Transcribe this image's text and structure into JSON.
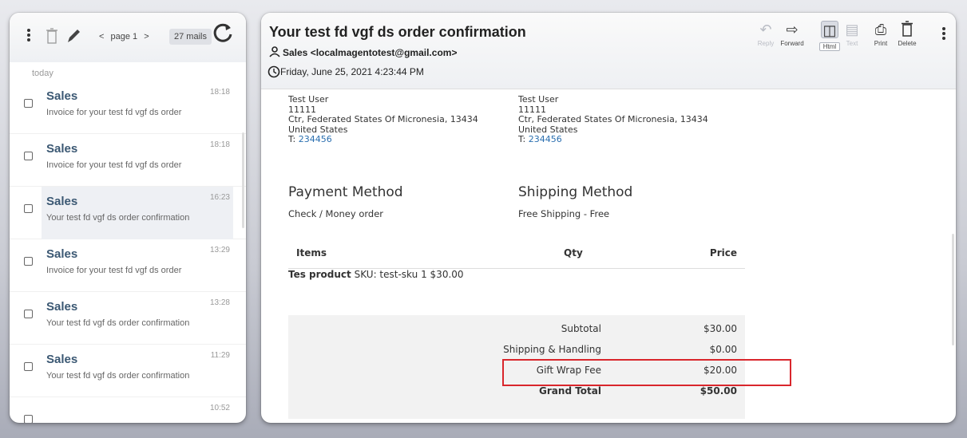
{
  "left": {
    "pager_prev": "<",
    "page_label": "page 1",
    "pager_next": ">",
    "mail_count": "27 mails",
    "group_label": "today",
    "items": [
      {
        "from": "Sales",
        "subject": "Invoice for your test fd vgf ds order",
        "time": "18:18"
      },
      {
        "from": "Sales",
        "subject": "Invoice for your test fd vgf ds order",
        "time": "18:18"
      },
      {
        "from": "Sales",
        "subject": "Your test fd vgf ds order confirmation",
        "time": "16:23"
      },
      {
        "from": "Sales",
        "subject": "Invoice for your test fd vgf ds order",
        "time": "13:29"
      },
      {
        "from": "Sales",
        "subject": "Your test fd vgf ds order confirmation",
        "time": "13:28"
      },
      {
        "from": "Sales",
        "subject": "Your test fd vgf ds order confirmation",
        "time": "11:29"
      },
      {
        "from": "",
        "subject": "",
        "time": "10:52"
      }
    ]
  },
  "message": {
    "subject": "Your test fd vgf ds order confirmation",
    "from": "Sales <localmagentotest@gmail.com>",
    "date": "Friday, June 25, 2021 4:23:44 PM"
  },
  "toolbar": {
    "reply": "Reply",
    "forward": "Forward",
    "html": "Html",
    "text": "Text",
    "print": "Print",
    "delete": "Delete"
  },
  "email": {
    "billing": {
      "name": "Test User",
      "line1": "11111",
      "line2": "Ctr, Federated States Of Micronesia, 13434",
      "country": "United States",
      "tel_prefix": "T: ",
      "tel": "234456"
    },
    "shipping": {
      "name": "Test User",
      "line1": "11111",
      "line2": "Ctr, Federated States Of Micronesia, 13434",
      "country": "United States",
      "tel_prefix": "T: ",
      "tel": "234456"
    },
    "payment_heading": "Payment Method",
    "payment_value": "Check / Money order",
    "shipping_heading": "Shipping Method",
    "shipping_value": "Free Shipping - Free",
    "table": {
      "col_items": "Items",
      "col_qty": "Qty",
      "col_price": "Price",
      "product_name": "Tes product",
      "product_sku": "SKU: test-sku",
      "product_qty": "1",
      "product_price": "$30.00",
      "subtotal_label": "Subtotal",
      "subtotal_value": "$30.00",
      "shipping_label": "Shipping & Handling",
      "shipping_value": "$0.00",
      "giftwrap_label": "Gift Wrap Fee",
      "giftwrap_value": "$20.00",
      "grand_label": "Grand Total",
      "grand_value": "$50.00"
    }
  },
  "colors": {
    "highlight_box": "#d9262c",
    "link": "#2a6fb0",
    "sender": "#3b5873"
  }
}
